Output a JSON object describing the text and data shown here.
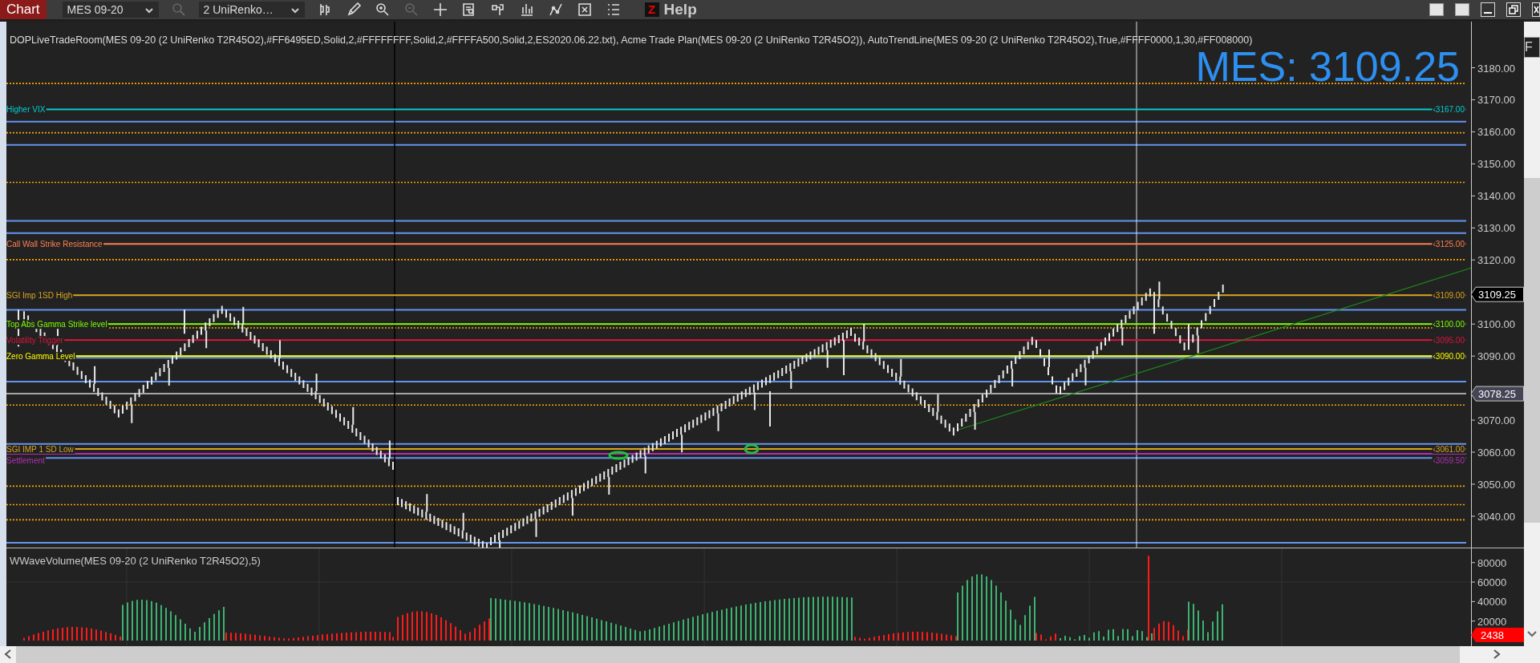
{
  "toolbar": {
    "tab": "Chart",
    "instrument": "MES 09-20",
    "bar_type": "2 UniRenko…",
    "z_logo": "Z",
    "help": "Help"
  },
  "indicator_label": "DOPLiveTradeRoom(MES 09-20 (2 UniRenko T2R45O2),#FF6495ED,Solid,2,#FFFFFFFF,Solid,2,#FFFFA500,Solid,2,ES2020.06.22.txt), Acme Trade Plan(MES 09-20 (2 UniRenko T2R45O2)), AutoTrendLine(MES 09-20 (2 UniRenko T2R45O2),True,#FFFF0000,1,30,#FF008000)",
  "last_price_display": "MES: 3109.25",
  "side_tab": "F",
  "price_panel": {
    "axis_labels": [
      "3180.00",
      "3170.00",
      "3160.00",
      "3150.00",
      "3140.00",
      "3130.00",
      "3120.00",
      "3100.00",
      "3090.00",
      "3070.00",
      "3060.00",
      "3050.00",
      "3040.00"
    ],
    "levels": [
      {
        "label": "Higher VIX",
        "price_label": "‹3167.00",
        "color": "#00ced1"
      },
      {
        "label": "Call Wall Strike Resistance",
        "price_label": "‹3125.00",
        "color": "#ff7f50"
      },
      {
        "label": "SGI Imp 1SD High",
        "price_label": "‹3109.00",
        "color": "#daa520"
      },
      {
        "label": "Top Abs Gamma Strike level",
        "price_label": "‹3100.00",
        "color": "#7cfc00"
      },
      {
        "label": "Volatility Trigger",
        "price_label": "‹3095.00",
        "color": "#dc143c"
      },
      {
        "label": "Zero Gamma Level",
        "price_label": "‹3090.00",
        "color": "#ffff00"
      },
      {
        "label": "SGI IMP 1 SD Low",
        "price_label": "‹3061.00",
        "color": "#daa520"
      },
      {
        "label": "Settlement",
        "price_label": "‹3059.50",
        "color": "#b030b0"
      }
    ],
    "badges": [
      {
        "text": "3109.25",
        "kind": "last"
      },
      {
        "text": "3078.25",
        "kind": "crosshair"
      }
    ]
  },
  "volume_panel": {
    "title": "WWaveVolume(MES 09-20 (2 UniRenko T2R45O2),5)",
    "axis_labels": [
      "80000",
      "60000",
      "40000",
      "20000"
    ],
    "badge": "2438"
  }
}
